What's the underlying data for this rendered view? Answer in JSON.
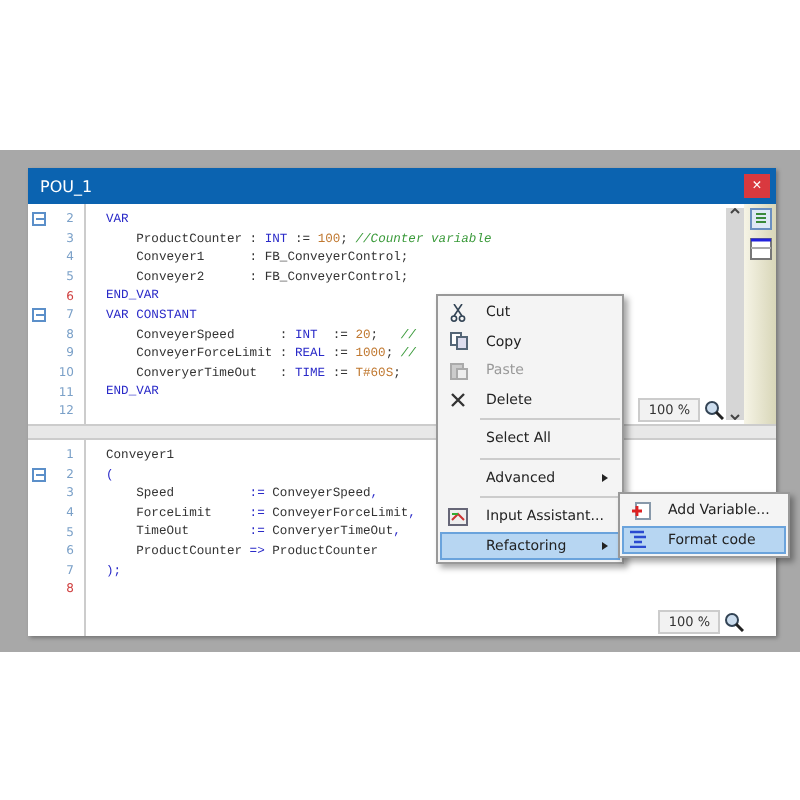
{
  "window": {
    "title": "POU_1",
    "close": "×"
  },
  "editors": [
    {
      "lines": [
        {
          "number": "2",
          "fold": true,
          "modified": false,
          "tokens": [
            {
              "kind": "keyword",
              "text": "VAR"
            }
          ]
        },
        {
          "number": "3",
          "fold": false,
          "modified": false,
          "tokens": [
            {
              "kind": "plain",
              "text": "    ProductCounter : "
            },
            {
              "kind": "keyword",
              "text": "INT"
            },
            {
              "kind": "plain",
              "text": " := "
            },
            {
              "kind": "number",
              "text": "100"
            },
            {
              "kind": "plain",
              "text": "; "
            },
            {
              "kind": "comment",
              "text": "//Counter variable"
            }
          ]
        },
        {
          "number": "4",
          "fold": false,
          "modified": false,
          "tokens": [
            {
              "kind": "plain",
              "text": "    Conveyer1      : FB_ConveyerControl;"
            }
          ]
        },
        {
          "number": "5",
          "fold": false,
          "modified": false,
          "tokens": [
            {
              "kind": "plain",
              "text": "    Conveyer2      : FB_ConveyerControl;"
            }
          ]
        },
        {
          "number": "6",
          "fold": false,
          "modified": true,
          "tokens": [
            {
              "kind": "keyword",
              "text": "END_VAR"
            }
          ]
        },
        {
          "number": "7",
          "fold": true,
          "modified": false,
          "tokens": [
            {
              "kind": "keyword",
              "text": "VAR CONSTANT"
            }
          ]
        },
        {
          "number": "8",
          "fold": false,
          "modified": false,
          "tokens": [
            {
              "kind": "plain",
              "text": "    ConveyerSpeed      : "
            },
            {
              "kind": "keyword",
              "text": "INT"
            },
            {
              "kind": "plain",
              "text": "  := "
            },
            {
              "kind": "number",
              "text": "20"
            },
            {
              "kind": "plain",
              "text": ";   "
            },
            {
              "kind": "comment",
              "text": "//"
            }
          ]
        },
        {
          "number": "9",
          "fold": false,
          "modified": false,
          "tokens": [
            {
              "kind": "plain",
              "text": "    ConveyerForceLimit : "
            },
            {
              "kind": "keyword",
              "text": "REAL"
            },
            {
              "kind": "plain",
              "text": " := "
            },
            {
              "kind": "number",
              "text": "1000"
            },
            {
              "kind": "plain",
              "text": "; "
            },
            {
              "kind": "comment",
              "text": "//"
            }
          ]
        },
        {
          "number": "10",
          "fold": false,
          "modified": false,
          "tokens": [
            {
              "kind": "plain",
              "text": "    ConveryerTimeOut   : "
            },
            {
              "kind": "keyword",
              "text": "TIME"
            },
            {
              "kind": "plain",
              "text": " := "
            },
            {
              "kind": "number",
              "text": "T#60S"
            },
            {
              "kind": "plain",
              "text": ";"
            }
          ]
        },
        {
          "number": "11",
          "fold": false,
          "modified": false,
          "tokens": [
            {
              "kind": "keyword",
              "text": "END_VAR"
            }
          ]
        },
        {
          "number": "12",
          "fold": false,
          "modified": false
        }
      ],
      "zoom": "100 %",
      "scrollbar": true
    },
    {
      "lines": [
        {
          "number": "1",
          "fold": false,
          "modified": false,
          "tokens": [
            {
              "kind": "plain",
              "text": "Conveyer1"
            }
          ]
        },
        {
          "number": "2",
          "fold": true,
          "modified": false,
          "tokens": [
            {
              "kind": "keyword",
              "text": "("
            }
          ]
        },
        {
          "number": "3",
          "fold": false,
          "modified": false,
          "tokens": [
            {
              "kind": "plain",
              "text": "    Speed          "
            },
            {
              "kind": "keyword",
              "text": ":="
            },
            {
              "kind": "plain",
              "text": " ConveyerSpeed"
            },
            {
              "kind": "keyword",
              "text": ","
            }
          ]
        },
        {
          "number": "4",
          "fold": false,
          "modified": false,
          "tokens": [
            {
              "kind": "plain",
              "text": "    ForceLimit     "
            },
            {
              "kind": "keyword",
              "text": ":="
            },
            {
              "kind": "plain",
              "text": " ConveyerForceLimit"
            },
            {
              "kind": "keyword",
              "text": ","
            }
          ]
        },
        {
          "number": "5",
          "fold": false,
          "modified": false,
          "tokens": [
            {
              "kind": "plain",
              "text": "    TimeOut        "
            },
            {
              "kind": "keyword",
              "text": ":="
            },
            {
              "kind": "plain",
              "text": " ConveryerTimeOut"
            },
            {
              "kind": "keyword",
              "text": ","
            }
          ]
        },
        {
          "number": "6",
          "fold": false,
          "modified": false,
          "tokens": [
            {
              "kind": "plain",
              "text": "    ProductCounter "
            },
            {
              "kind": "keyword",
              "text": "=>"
            },
            {
              "kind": "plain",
              "text": " ProductCounter"
            }
          ]
        },
        {
          "number": "7",
          "fold": false,
          "modified": false,
          "tokens": [
            {
              "kind": "keyword",
              "text": ");"
            }
          ]
        },
        {
          "number": "8",
          "fold": false,
          "modified": true
        }
      ],
      "zoom": "100 %",
      "scrollbar": false
    }
  ],
  "context_menu": {
    "items": [
      {
        "kind": "item",
        "label": "Cut",
        "disabled": false,
        "submenu": false,
        "selected": false
      },
      {
        "kind": "item",
        "label": "Copy",
        "disabled": false,
        "submenu": false,
        "selected": false
      },
      {
        "kind": "item",
        "label": "Paste",
        "disabled": true,
        "submenu": false,
        "selected": false
      },
      {
        "kind": "item",
        "label": "Delete",
        "disabled": false,
        "submenu": false,
        "selected": false
      },
      {
        "kind": "separator"
      },
      {
        "kind": "item",
        "label": "Select All",
        "disabled": false,
        "submenu": false,
        "selected": false
      },
      {
        "kind": "separator"
      },
      {
        "kind": "item",
        "label": "Advanced",
        "disabled": false,
        "submenu": true,
        "selected": false
      },
      {
        "kind": "separator"
      },
      {
        "kind": "item",
        "label": "Input Assistant...",
        "disabled": false,
        "submenu": false,
        "selected": false
      },
      {
        "kind": "item",
        "label": "Refactoring",
        "disabled": false,
        "submenu": true,
        "selected": true
      }
    ]
  },
  "submenu": {
    "items": [
      {
        "label": "Add Variable...",
        "selected": false
      },
      {
        "label": "Format code",
        "selected": true
      }
    ]
  }
}
